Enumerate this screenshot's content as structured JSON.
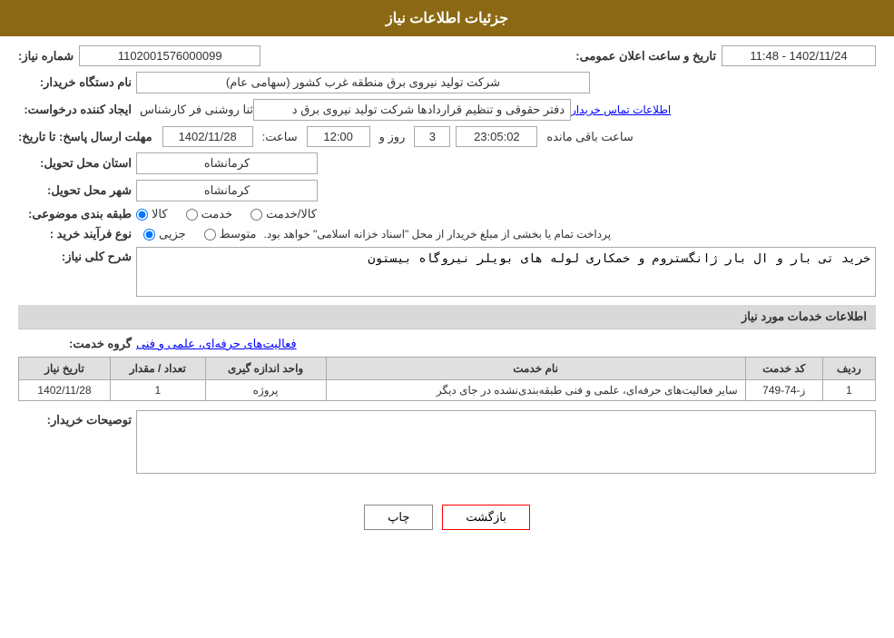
{
  "header": {
    "title": "جزئیات اطلاعات نیاز"
  },
  "top_row": {
    "need_number_label": "شماره نیاز:",
    "need_number_value": "1102001576000099",
    "announce_label": "تاریخ و ساعت اعلان عمومی:",
    "announce_value": "1402/11/24 - 11:48"
  },
  "buyer_org_label": "نام دستگاه خریدار:",
  "buyer_org_value": "شرکت تولید نیروی برق منطقه غرب کشور (سهامی عام)",
  "creator_label": "ایجاد کننده درخواست:",
  "creator_value": "دفتر حقوقی و تنظیم قراردادها شرکت تولید نیروی برق د",
  "creator_link": "اطلاعات تماس خریدار",
  "creator_prefix": "ثنا روشنی فر کارشناس",
  "deadline_label": "مهلت ارسال پاسخ: تا تاریخ:",
  "deadline_date": "1402/11/28",
  "deadline_time_label": "ساعت:",
  "deadline_time": "12:00",
  "deadline_days_label": "روز و",
  "deadline_days": "3",
  "deadline_countdown_label": "ساعت باقی مانده",
  "deadline_countdown": "23:05:02",
  "province_label": "استان محل تحویل:",
  "province_value": "کرمانشاه",
  "city_label": "شهر محل تحویل:",
  "city_value": "کرمانشاه",
  "category_label": "طبقه بندی موضوعی:",
  "category_options": [
    {
      "label": "کالا",
      "value": "kala",
      "checked": true
    },
    {
      "label": "خدمت",
      "value": "khedmat",
      "checked": false
    },
    {
      "label": "کالا/خدمت",
      "value": "kala_khedmat",
      "checked": false
    }
  ],
  "purchase_type_label": "نوع فرآیند خرید :",
  "purchase_type_options": [
    {
      "label": "جزیی",
      "value": "jozii",
      "checked": true
    },
    {
      "label": "متوسط",
      "value": "motavaset",
      "checked": false
    }
  ],
  "purchase_type_note": "پرداخت تمام یا بخشی از مبلغ خریدار از محل \"اسناد خزانه اسلامی\" خواهد بود.",
  "need_description_label": "شرح کلی نیاز:",
  "need_description_value": "خرید تی بار و ال بار ژانگستروم و خمکاری لوله های بویلر نیروگاه بیستون",
  "services_section_title": "اطلاعات خدمات مورد نیاز",
  "service_group_label": "گروه خدمت:",
  "service_group_value": "فعالیت‌های حرفه‌ای، علمی و فنی",
  "service_table": {
    "columns": [
      "ردیف",
      "کد خدمت",
      "نام خدمت",
      "واحد اندازه گیری",
      "تعداد / مقدار",
      "تاریخ نیاز"
    ],
    "rows": [
      {
        "row_num": "1",
        "service_code": "ز-74-749",
        "service_name": "سایر فعالیت‌های حرفه‌ای، علمی و فنی طبقه‌بندی‌نشده در جای دیگر",
        "unit": "پروژه",
        "quantity": "1",
        "date": "1402/11/28"
      }
    ]
  },
  "buyer_description_label": "توصیحات خریدار:",
  "buyer_description_value": "",
  "buttons": {
    "print_label": "چاپ",
    "back_label": "بازگشت"
  }
}
